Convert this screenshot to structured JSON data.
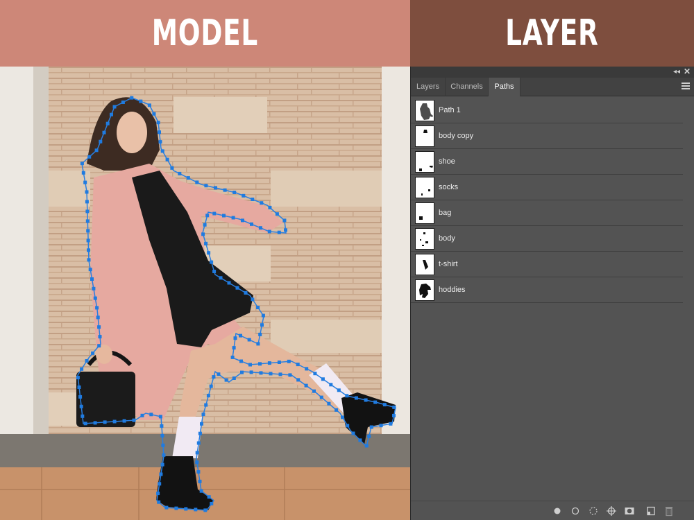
{
  "banners": {
    "left_title": "MODEL",
    "right_title": "LAYER"
  },
  "colors": {
    "left_banner": "#cd8778",
    "right_banner": "#7e4e3e",
    "panel": "#535353",
    "path_anchor": "#1f7be0"
  },
  "panel": {
    "collapse_icon": "double-chevron-left-icon",
    "close_icon": "close-icon",
    "tabs": [
      {
        "label": "Layers",
        "active": false
      },
      {
        "label": "Channels",
        "active": false
      },
      {
        "label": "Paths",
        "active": true
      }
    ],
    "menu_icon": "panel-menu-icon",
    "paths": [
      {
        "name": "Path 1"
      },
      {
        "name": "body copy"
      },
      {
        "name": "shoe"
      },
      {
        "name": "socks"
      },
      {
        "name": "bag"
      },
      {
        "name": "body"
      },
      {
        "name": "t-shirt"
      },
      {
        "name": "hoddies"
      }
    ],
    "bottom_icons": [
      "fill-path-icon",
      "stroke-path-icon",
      "load-as-selection-icon",
      "make-work-path-icon",
      "add-mask-icon",
      "new-path-icon",
      "delete-path-icon"
    ]
  }
}
